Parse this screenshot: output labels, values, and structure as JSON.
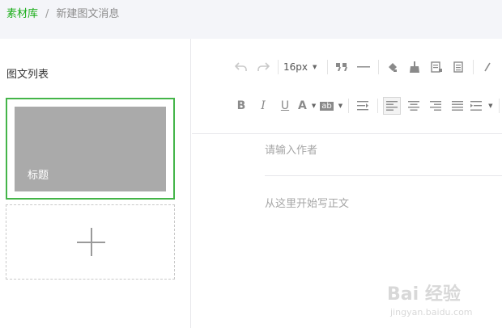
{
  "breadcrumb": {
    "parent": "素材库",
    "separator": "/",
    "current": "新建图文消息"
  },
  "sidebar": {
    "title": "图文列表",
    "card": {
      "cover_title": "标题"
    },
    "add_icon": "plus-icon"
  },
  "toolbar": {
    "row1": [
      "undo-icon",
      "redo-icon",
      "font-size-select",
      "blockquote-icon",
      "horizontal-rule-icon",
      "format-painter-icon",
      "clear-format-icon",
      "insert-template-icon",
      "page-icon",
      "link-icon"
    ],
    "font_size": "16px",
    "row2": [
      "bold-icon",
      "italic-icon",
      "underline-icon",
      "font-color-icon",
      "background-color-icon",
      "indent-icon",
      "align-left-icon",
      "align-center-icon",
      "align-right-icon",
      "justify-icon",
      "line-spacing-icon",
      "paragraph-spacing-icon"
    ],
    "bold": "B",
    "italic": "I",
    "underline": "U",
    "font_color": "A",
    "bg_color": "ab"
  },
  "editor": {
    "author_placeholder": "请输入作者",
    "body_placeholder": "从这里开始写正文"
  },
  "watermark": {
    "brand": "Bai 经验",
    "site": "jingyan.baidu.com"
  },
  "colors": {
    "accent": "#44b549",
    "link": "#1aad19",
    "cover": "#aaaaaa",
    "topbar": "#f4f5f9"
  }
}
